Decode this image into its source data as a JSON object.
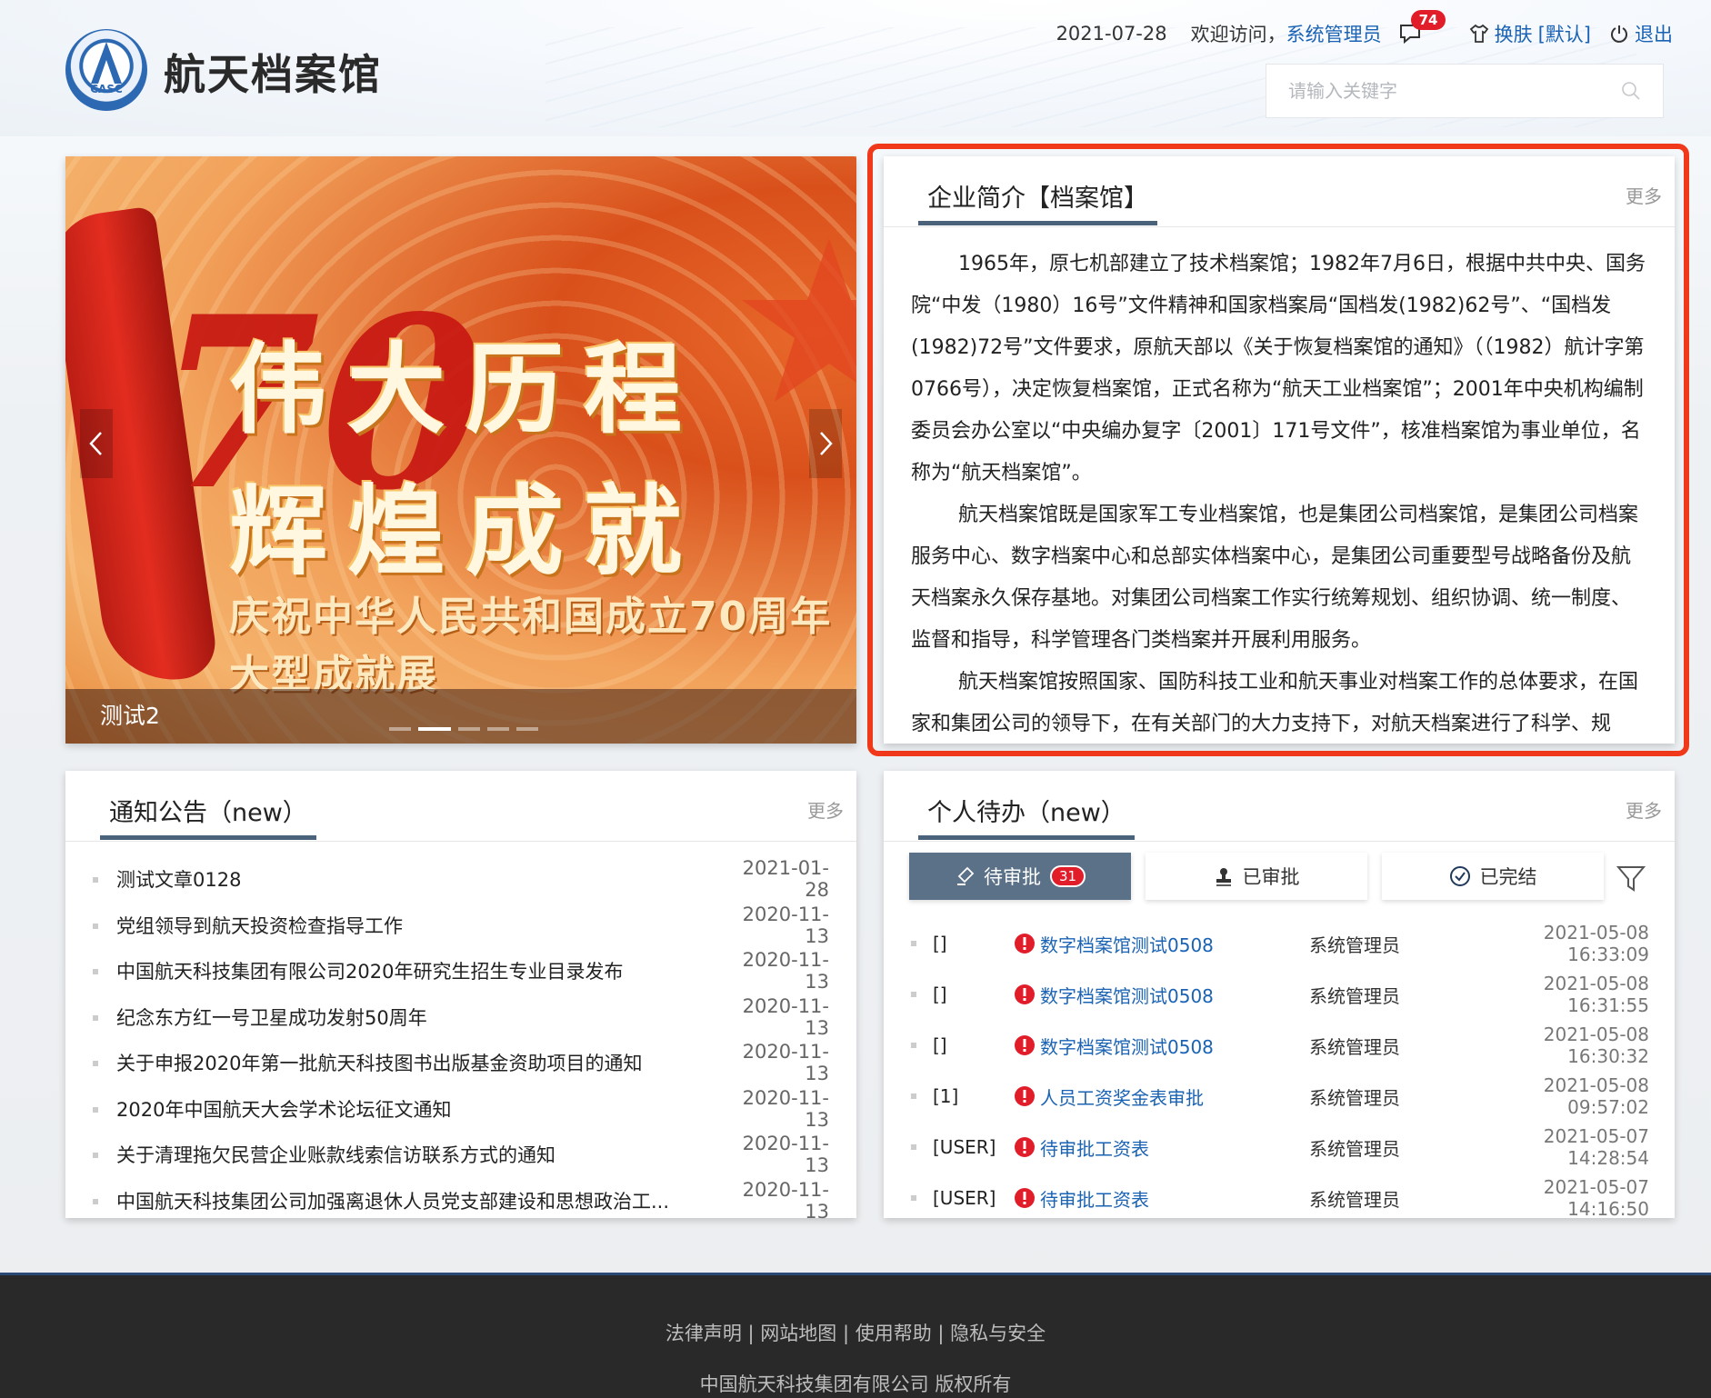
{
  "header": {
    "logo_alt": "CASC",
    "site_title": "航天档案馆",
    "date": "2021-07-28",
    "welcome": "欢迎访问，",
    "username": "系统管理员",
    "message_count": "74",
    "skin_label": "换肤",
    "skin_current": "[默认]",
    "logout_label": "退出",
    "search_placeholder": "请输入关键字"
  },
  "banner": {
    "slogan": "伟大历程 辉煌成就",
    "subline": "庆祝中华人民共和国成立70周年大型成就展",
    "emblem_number": "70",
    "caption": "测试2",
    "slide_count": 5,
    "active_slide": 2
  },
  "intro": {
    "title": "企业简介【档案馆】",
    "more": "更多",
    "paragraphs": [
      "1965年，原七机部建立了技术档案馆；1982年7月6日，根据中共中央、国务院“中发（1980）16号”文件精神和国家档案局“国档发(1982)62号”、“国档发(1982)72号”文件要求，原航天部以《关于恢复档案馆的通知》（（1982）航计字第0766号），决定恢复档案馆，正式名称为“航天工业档案馆”；2001年中央机构编制委员会办公室以“中央编办复字〔2001〕171号文件”，核准档案馆为事业单位，名称为“航天档案馆”。",
      "航天档案馆既是国家军工专业档案馆，也是集团公司档案馆，是集团公司档案服务中心、数字档案中心和总部实体档案中心，是集团公司重要型号战略备份及航天档案永久保存基地。对集团公司档案工作实行统筹规划、组织协调、统一制度、监督和指导，科学管理各门类档案并开展利用服务。",
      "航天档案馆按照国家、国防科技工业和航天事业对档案工作的总体要求，在国家和集团公司的领导下，在有关部门的大力支持下，对航天档案进行了科学、规"
    ]
  },
  "notices": {
    "title": "通知公告（new）",
    "more": "更多",
    "items": [
      {
        "title": "测试文章0128",
        "date": "2021-01-28"
      },
      {
        "title": "党组领导到航天投资检查指导工作",
        "date": "2020-11-13"
      },
      {
        "title": "中国航天科技集团有限公司2020年研究生招生专业目录发布",
        "date": "2020-11-13"
      },
      {
        "title": "纪念东方红一号卫星成功发射50周年",
        "date": "2020-11-13"
      },
      {
        "title": "关于申报2020年第一批航天科技图书出版基金资助项目的通知",
        "date": "2020-11-13"
      },
      {
        "title": "2020年中国航天大会学术论坛征文通知",
        "date": "2020-11-13"
      },
      {
        "title": "关于清理拖欠民营企业账款线索信访联系方式的通知",
        "date": "2020-11-13"
      },
      {
        "title": "中国航天科技集团公司加强离退休人员党支部建设和思想政治工...",
        "date": "2020-11-13"
      }
    ]
  },
  "todo": {
    "title": "个人待办（new）",
    "more": "更多",
    "tabs": [
      {
        "label": "待审批",
        "count": "31"
      },
      {
        "label": "已审批"
      },
      {
        "label": "已完结"
      }
    ],
    "items": [
      {
        "tag": "[]",
        "name": "数字档案馆测试0508",
        "who": "系统管理员",
        "time": "2021-05-08 16:33:09"
      },
      {
        "tag": "[]",
        "name": "数字档案馆测试0508",
        "who": "系统管理员",
        "time": "2021-05-08 16:31:55"
      },
      {
        "tag": "[]",
        "name": "数字档案馆测试0508",
        "who": "系统管理员",
        "time": "2021-05-08 16:30:32"
      },
      {
        "tag": "[1]",
        "name": "人员工资奖金表审批",
        "who": "系统管理员",
        "time": "2021-05-08 09:57:02"
      },
      {
        "tag": "[USER]",
        "name": "待审批工资表",
        "who": "系统管理员",
        "time": "2021-05-07 14:28:54"
      },
      {
        "tag": "[USER]",
        "name": "待审批工资表",
        "who": "系统管理员",
        "time": "2021-05-07 14:16:50"
      }
    ]
  },
  "footer": {
    "links": "法律声明 | 网站地图 | 使用帮助 | 隐私与安全",
    "copyright": "中国航天科技集团有限公司 版权所有"
  },
  "colors": {
    "accent_blue": "#1a63b4",
    "badge_red": "#e11d2a",
    "highlight_border": "#f0391b",
    "tab_active": "#5b7188",
    "footer_bg": "#292929"
  }
}
